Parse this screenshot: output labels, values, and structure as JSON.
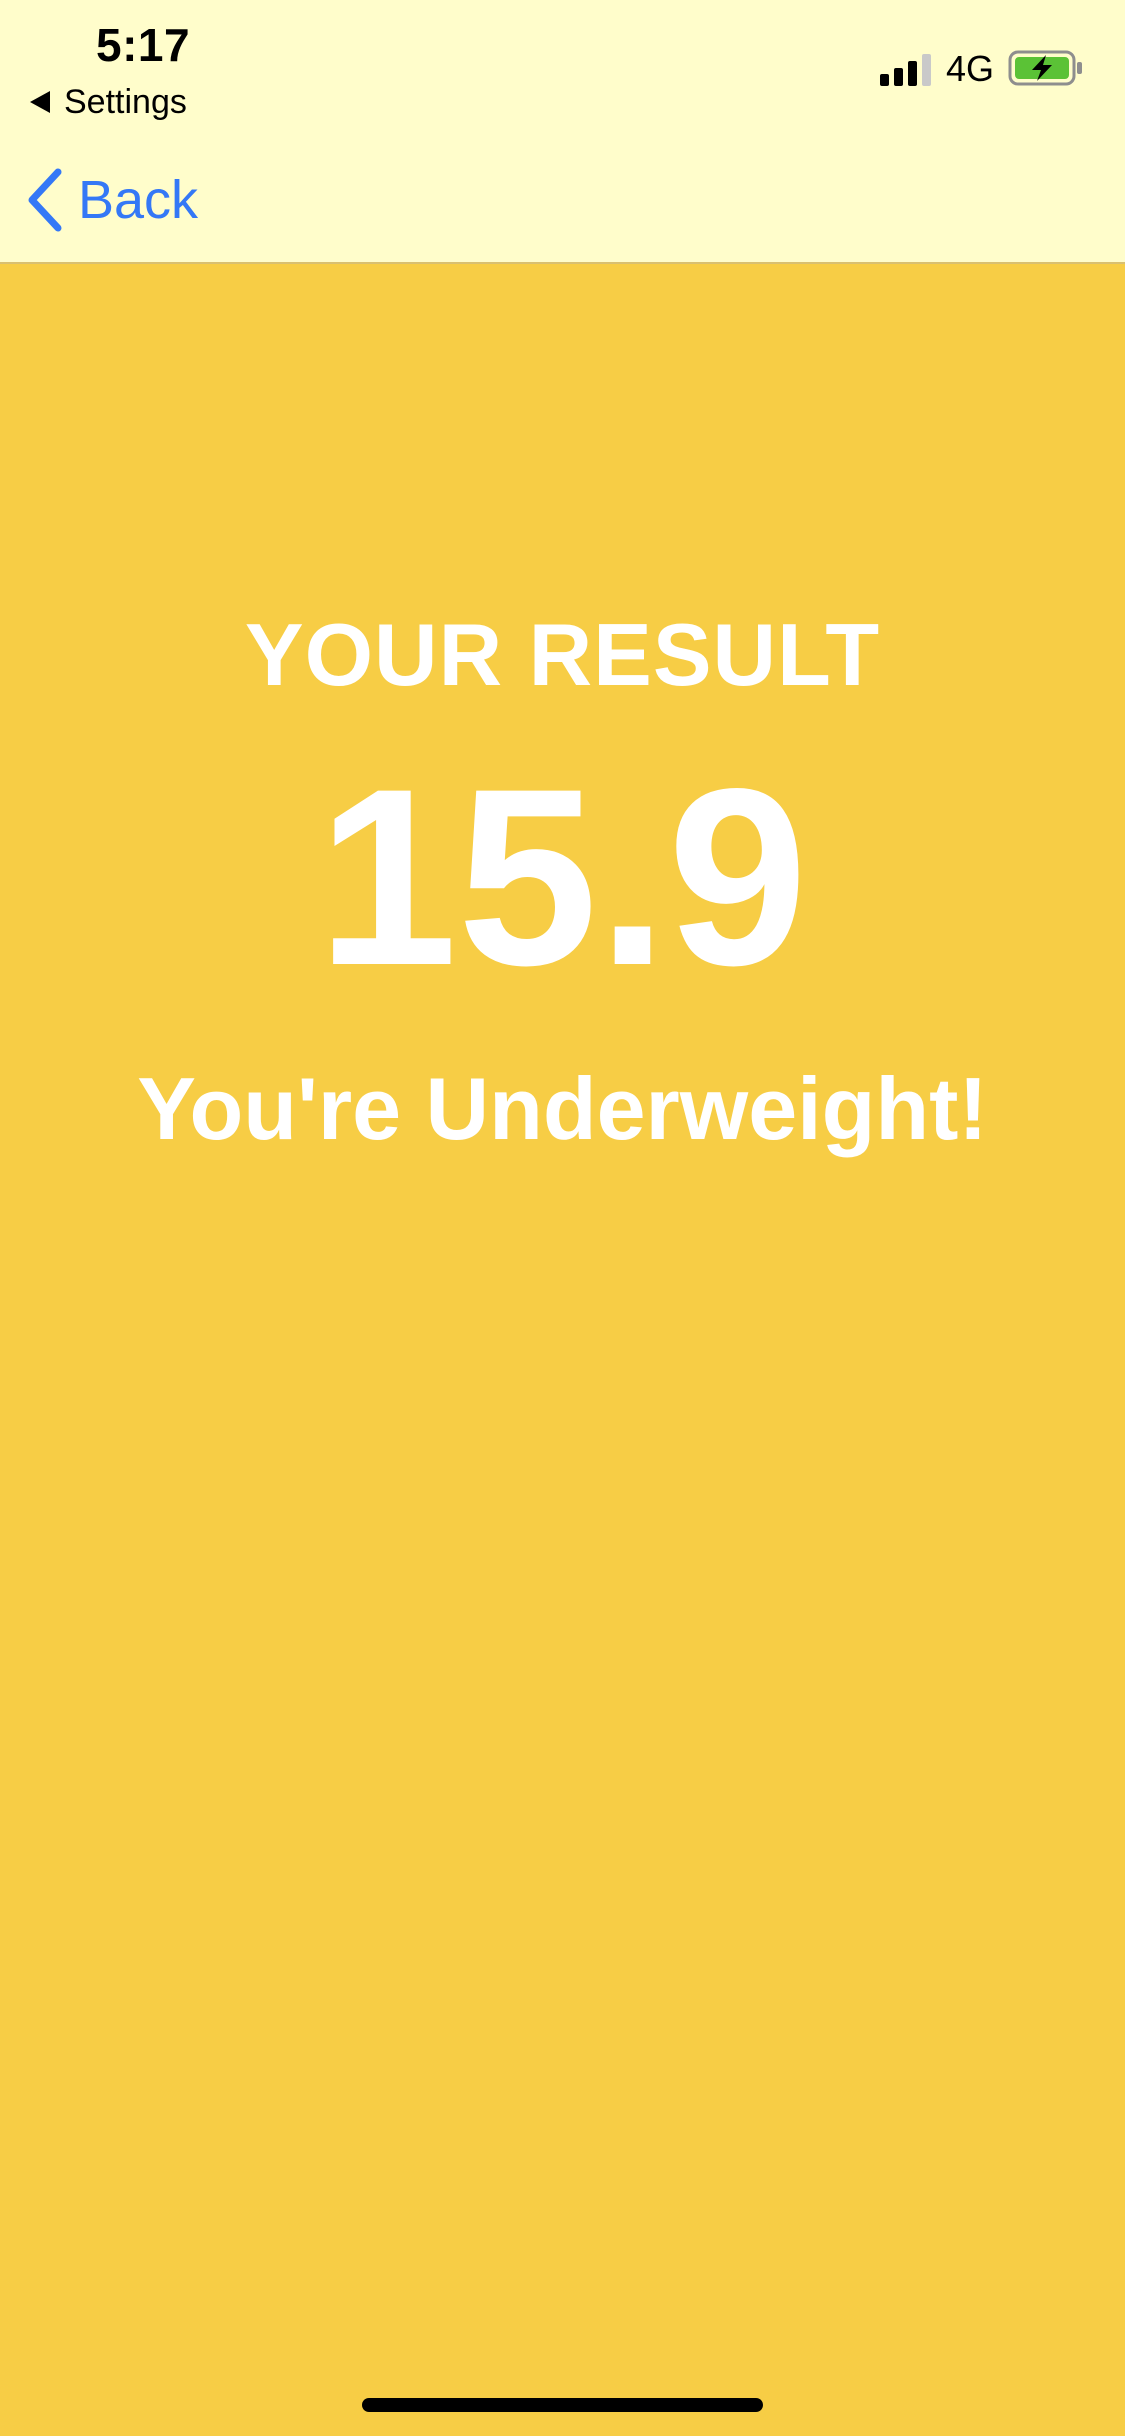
{
  "status_bar": {
    "time": "5:17",
    "back_to_app_label": "Settings",
    "network": "4G",
    "signal_icon": "cellular-signal-icon",
    "battery_icon": "battery-charging-icon"
  },
  "nav": {
    "back_label": "Back",
    "back_icon": "chevron-left-icon"
  },
  "result": {
    "title": "YOUR RESULT",
    "value": "15.9",
    "message": "You're Underweight!"
  },
  "colors": {
    "background": "#F7CD45",
    "topbar": "#FFFDCB",
    "link": "#3478F6",
    "text": "#FFFFFF",
    "battery": "#5BC236"
  }
}
